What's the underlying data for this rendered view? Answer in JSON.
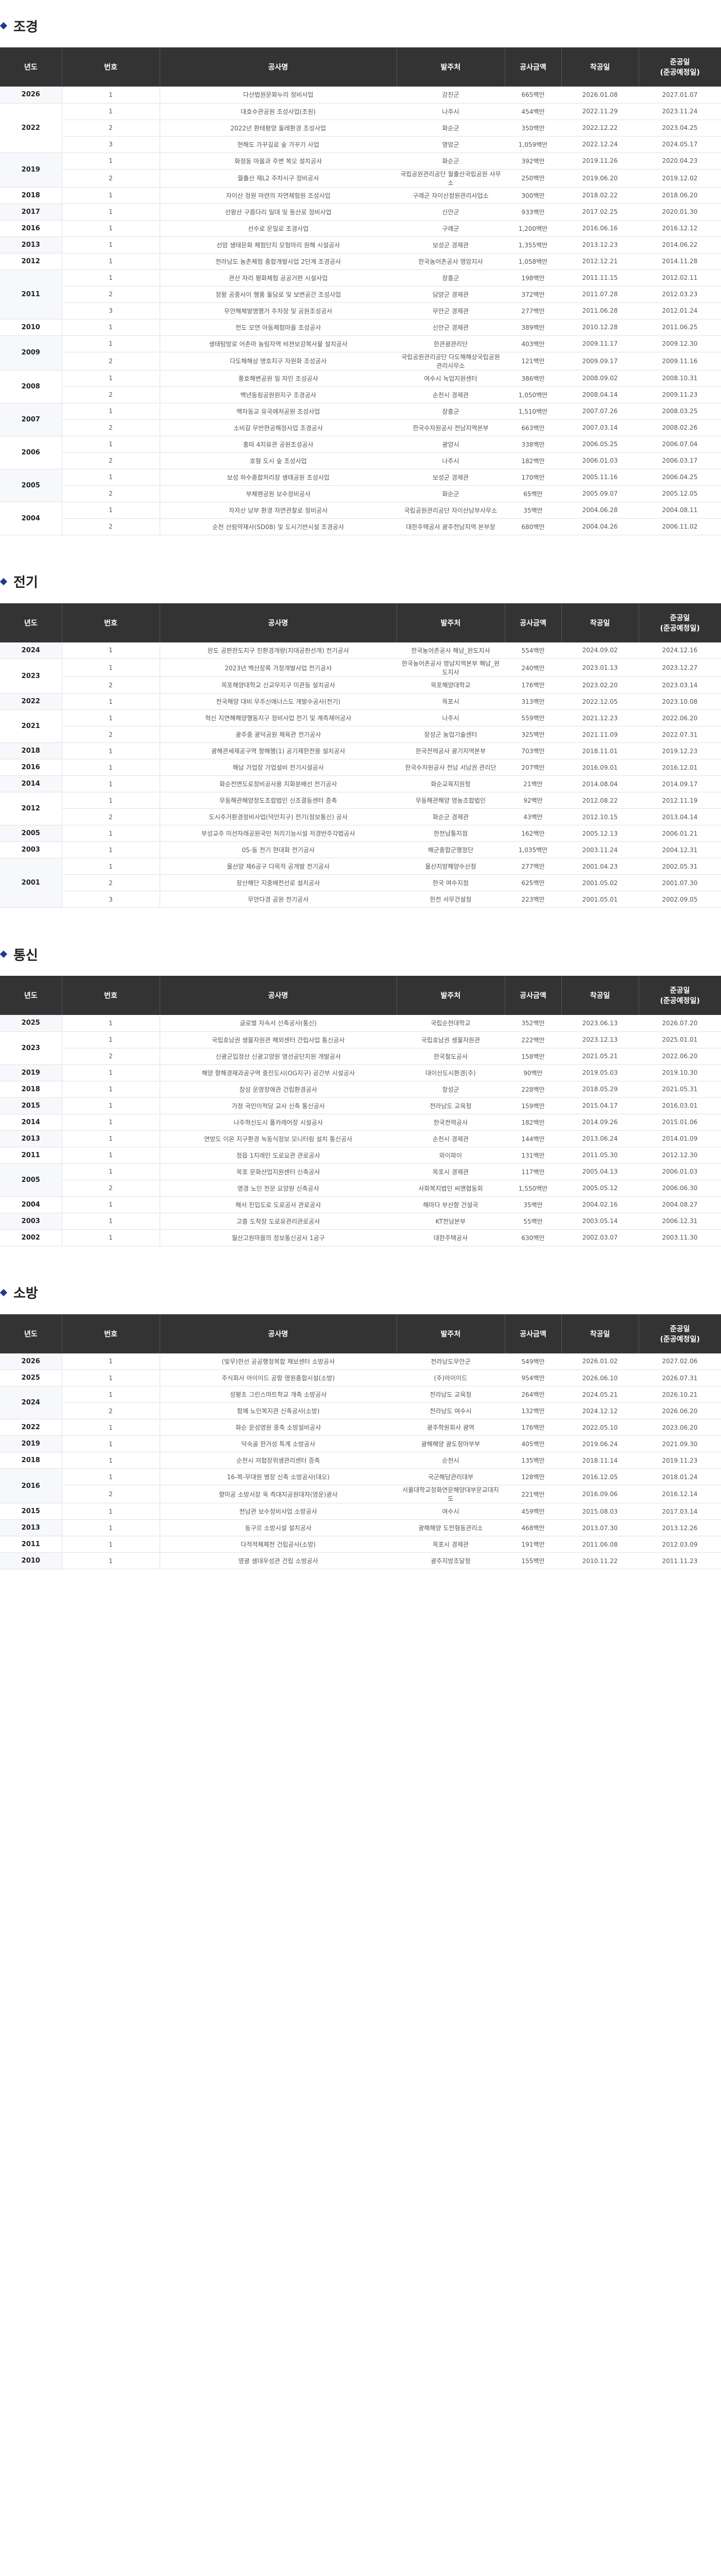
{
  "headers": [
    "년도",
    "번호",
    "공사명",
    "발주처",
    "공사금액",
    "착공일",
    "준공일\n(준공예정일)"
  ],
  "sections": [
    {
      "title": "조경",
      "groups": [
        {
          "year": "2026",
          "rows": [
            [
              "1",
              "다산법원문화누리 정비사업",
              "강진군",
              "665백만",
              "2026.01.08",
              "2027.01.07"
            ]
          ]
        },
        {
          "year": "2022",
          "rows": [
            [
              "1",
              "대호수관공원 조성사업(조원)",
              "나주시",
              "454백만",
              "2022.11.29",
              "2023.11.24"
            ],
            [
              "2",
              "2022년 환태평양 둘레환경 조성사업",
              "화순군",
              "350백만",
              "2022.12.22",
              "2023.04.25"
            ],
            [
              "3",
              "현해도 가꾸길로 숲 가꾸기 사업",
              "영암군",
              "1,059백만",
              "2022.12.24",
              "2024.05.17"
            ]
          ]
        },
        {
          "year": "2019",
          "rows": [
            [
              "1",
              "화정동 마을과 주변 복오 설치공사",
              "화순군",
              "392백만",
              "2019.11.26",
              "2020.04.23"
            ],
            [
              "2",
              "월출산 제L2 주차시구 정비공사",
              "국립공원관리공단 월출산국립공원 사무소",
              "250백만",
              "2019.06.20",
              "2019.12.02"
            ]
          ]
        },
        {
          "year": "2018",
          "rows": [
            [
              "1",
              "자이산 정원 마련의 자연체험원 조성사업",
              "구례군 자이산정원관리사업소",
              "300백만",
              "2018.02.22",
              "2018.06.20"
            ]
          ]
        },
        {
          "year": "2017",
          "rows": [
            [
              "1",
              "선왕산 구름다리 일대 및 등산로 정비사업",
              "신안군",
              "933백만",
              "2017.02.25",
              "2020.01.30"
            ]
          ]
        },
        {
          "year": "2016",
          "rows": [
            [
              "1",
              "선수로 문일로 조경사업",
              "구례군",
              "1,200백만",
              "2016.06.16",
              "2016.12.12"
            ]
          ]
        },
        {
          "year": "2013",
          "rows": [
            [
              "1",
              "선암 생태문화 체험단지 모험마리 원해 시설공사",
              "보성군 경제관",
              "1,355백만",
              "2013.12.23",
              "2014.06.22"
            ]
          ]
        },
        {
          "year": "2012",
          "rows": [
            [
              "1",
              "전라남도 농촌체험 종합개발사업 2단계 조경공사",
              "한국농어촌공사 영암지사",
              "1,058백만",
              "2012.12.21",
              "2014.11.28"
            ]
          ]
        },
        {
          "year": "2011",
          "rows": [
            [
              "1",
              "관산 자리 평화체험 공공거판 시설사업",
              "장흥군",
              "198백만",
              "2011.11.15",
              "2012.02.11"
            ],
            [
              "2",
              "정왕 공중사이 행풍 둘담로 및 보변공간 조성사업",
              "담양군 경제관",
              "372백만",
              "2011.07.28",
              "2012.03.23"
            ],
            [
              "3",
              "무안해체발명행거 주차장 및 공원조성공사",
              "무안군 경제관",
              "277백만",
              "2011.06.28",
              "2012.01.24"
            ]
          ]
        },
        {
          "year": "2010",
          "rows": [
            [
              "1",
              "전도 모연 아동체험마을 조성공사",
              "신안군 경제관",
              "389백만",
              "2010.12.28",
              "2011.06.25"
            ]
          ]
        },
        {
          "year": "2009",
          "rows": [
            [
              "1",
              "생태탐방로 어촌마 농림자역 비젼보강복사물 설치공사",
              "한관광관리단",
              "403백만",
              "2009.11.17",
              "2009.12.30"
            ],
            [
              "2",
              "다도해해상 명호지구 자원화 조성공사",
              "국립공원관리공단 다도해해상국립공원관리사무소",
              "121백만",
              "2009.09.17",
              "2009.11.16"
            ]
          ]
        },
        {
          "year": "2008",
          "rows": [
            [
              "1",
              "풍호해변공원 일 자인 조성공사",
              "여수시 녹업지원센터",
              "386백만",
              "2008.09.02",
              "2008.10.31"
            ],
            [
              "2",
              "백년동림공원원지구 조경공사",
              "순천시 경제관",
              "1,050백만",
              "2008.04.14",
              "2009.11.23"
            ]
          ]
        },
        {
          "year": "2007",
          "rows": [
            [
              "1",
              "백자동교 유국에처공원 조성사업",
              "장흥군",
              "1,510백만",
              "2007.07.26",
              "2008.03.25"
            ],
            [
              "2",
              "소비갈 무반현공해정사업 조경공사",
              "한국수자원공사 전남지역본부",
              "663백만",
              "2007.03.14",
              "2008.02.26"
            ]
          ]
        },
        {
          "year": "2006",
          "rows": [
            [
              "1",
              "홍따 4지유관 공원조성공사",
              "광양시",
              "338백만",
              "2006.05.25",
              "2006.07.04"
            ],
            [
              "2",
              "호형 도시 숲 조성사업",
              "나주시",
              "182백만",
              "2006.01.03",
              "2006.03.17"
            ]
          ]
        },
        {
          "year": "2005",
          "rows": [
            [
              "1",
              "보성 하수종합처리장 생태공원 조성사업",
              "보성군 경제관",
              "170백만",
              "2005.11.16",
              "2006.04.25"
            ],
            [
              "2",
              "부체렌공원 보수정비공사",
              "화순군",
              "65백만",
              "2005.09.07",
              "2005.12.05"
            ]
          ]
        },
        {
          "year": "2004",
          "rows": [
            [
              "1",
              "자자산 남부 환경 자연관찰로 정비공사",
              "국립공원관리공단 자이산남부사무소",
              "35백만",
              "2004.06.28",
              "2004.08.11"
            ],
            [
              "2",
              "순천 산림약재사(SD08) 및 도시기반시설 조경공사",
              "대한주택공사 광주전남지역 본부장",
              "680백만",
              "2004.04.26",
              "2006.11.02"
            ]
          ]
        }
      ]
    },
    {
      "title": "전기",
      "groups": [
        {
          "year": "2024",
          "rows": [
            [
              "1",
              "완도 공판한도지구 진환경개량(지대공판선개) 전기공사",
              "한국농어촌공사 해남_완도지사",
              "554백만",
              "2024.09.02",
              "2024.12.16"
            ]
          ]
        },
        {
          "year": "2023",
          "rows": [
            [
              "1",
              "2023년 백산장록 가정개발사업 전기공사",
              "한국농어촌공사 영남지역본부 해남_완도지사",
              "240백만",
              "2023.01.13",
              "2023.12.27"
            ],
            [
              "2",
              "목포해양대학교 신교무지구 미관동 설치공사",
              "목포해양대학교",
              "176백만",
              "2023.02.20",
              "2023.03.14"
            ]
          ]
        },
        {
          "year": "2022",
          "rows": [
            [
              "1",
              "전국해양 대비 무주신에너스도 개발수공사(전기)",
              "목포시",
              "313백만",
              "2022.12.05",
              "2023.10.08"
            ]
          ]
        },
        {
          "year": "2021",
          "rows": [
            [
              "1",
              "혁신 지연해해양행동지구 정비사업 전기 및 계측제어공사",
              "나주시",
              "559백만",
              "2021.12.23",
              "2022.06.20"
            ],
            [
              "2",
              "광주중 광덕공원 체육관 전기공사",
              "장성군 농업기술센터",
              "325백만",
              "2021.11.09",
              "2022.07.31"
            ]
          ]
        },
        {
          "year": "2018",
          "rows": [
            [
              "1",
              "광해관세제공구역 항해행(1) 공기제한전용 설치공사",
              "한국전력공사 광기지역본부",
              "703백만",
              "2018.11.01",
              "2019.12.23"
            ]
          ]
        },
        {
          "year": "2016",
          "rows": [
            [
              "1",
              "해남 가업장 가업설비 전기시설공사",
              "한국수자원공사 전남 서남권 관리단",
              "207백만",
              "2016.09.01",
              "2016.12.01"
            ]
          ]
        },
        {
          "year": "2014",
          "rows": [
            [
              "1",
              "화순전면도로정비공사용 지화분배선 전기공사",
              "화순교육지원청",
              "21백만",
              "2014.08.04",
              "2014.09.17"
            ]
          ]
        },
        {
          "year": "2012",
          "rows": [
            [
              "1",
              "무동해관해양정도조합법인 신조결동센터 증축",
              "무동해관해양 영농조합법인",
              "92백만",
              "2012.08.22",
              "2012.11.19"
            ],
            [
              "2",
              "도시주거환경정비사업(덕안지구) 전기(정보통신) 공사",
              "화순군 경제관",
              "43백만",
              "2012.10.15",
              "2013.04.14"
            ]
          ]
        },
        {
          "year": "2005",
          "rows": [
            [
              "1",
              "부성교주 미선자래공원국민 처리기능시설 저경반주각법공사",
              "한전남통지점",
              "162백만",
              "2005.12.13",
              "2006.01.21"
            ]
          ]
        },
        {
          "year": "2003",
          "rows": [
            [
              "1",
              "05-동 전기 현대화 전기공사",
              "해군종합군행정단",
              "1,035백만",
              "2003.11.24",
              "2004.12.31"
            ]
          ]
        },
        {
          "year": "2001",
          "rows": [
            [
              "1",
              "울산양 제6공구 다목적 공개발 전기공사",
              "울산지방해양수산청",
              "277백만",
              "2001.04.23",
              "2002.05.31"
            ],
            [
              "2",
              "장산해단 지중배전선로 설치공사",
              "한국 여수지점",
              "625백만",
              "2001.05.02",
              "2001.07.30"
            ],
            [
              "3",
              "무안다경 공원 전기공사",
              "한전 서무건설청",
              "223백만",
              "2001.05.01",
              "2002.09.05"
            ]
          ]
        }
      ]
    },
    {
      "title": "통신",
      "groups": [
        {
          "year": "2025",
          "rows": [
            [
              "1",
              "글로벌 자속서 신축공사(통신)",
              "국립순천대학교",
              "352백만",
              "2023.06.13",
              "2026.07.20"
            ]
          ]
        },
        {
          "year": "2023",
          "rows": [
            [
              "1",
              "국립호남권 생물자원관 해외센터 건립사업 통신공사",
              "국립호남권 생물자원관",
              "222백만",
              "2023.12.13",
              "2025.01.01"
            ],
            [
              "2",
              "신광군입정산 신광고양원 영선공단지원 개발공사",
              "한국철도공사",
              "158백만",
              "2021.05.21",
              "2022.06.20"
            ]
          ]
        },
        {
          "year": "2019",
          "rows": [
            [
              "1",
              "해양 항해경재과공구역 중진도시(OG지구) 공간부 시설공사",
              "대이산도시환경(주)",
              "90백만",
              "2019.05.03",
              "2019.10.30"
            ]
          ]
        },
        {
          "year": "2018",
          "rows": [
            [
              "1",
              "창성 운영장애관 건립환경공사",
              "창성군",
              "228백만",
              "2018.05.29",
              "2021.05.31"
            ]
          ]
        },
        {
          "year": "2015",
          "rows": [
            [
              "1",
              "가정 국민이적당 교사 신축 통신공사",
              "전라남도 교육청",
              "159백만",
              "2015.04.17",
              "2016.03.01"
            ]
          ]
        },
        {
          "year": "2014",
          "rows": [
            [
              "1",
              "나주혁신도시 폴카레어장 시설공사",
              "한국전력공사",
              "182백만",
              "2014.09.26",
              "2015.01.06"
            ]
          ]
        },
        {
          "year": "2013",
          "rows": [
            [
              "1",
              "연방도 이온 지구환경 녹동식정보 모니터링 설치 통신공사",
              "순천시 경제관",
              "144백만",
              "2013.06.24",
              "2014.01.09"
            ]
          ]
        },
        {
          "year": "2011",
          "rows": [
            [
              "1",
              "정읍 1지레인 도로요관 관로공사",
              "와이파이",
              "131백만",
              "2011.05.30",
              "2012.12.30"
            ]
          ]
        },
        {
          "year": "2005",
          "rows": [
            [
              "1",
              "목포 문화산업지원센터 신축공사",
              "목포시 경제관",
              "117백만",
              "2005.04.13",
              "2006.01.03"
            ],
            [
              "2",
              "영경 노인 전문 요양원 신축공사",
              "사회복지법인 씨앤협동회",
              "1,550백만",
              "2005.05.12",
              "2006.06.30"
            ]
          ]
        },
        {
          "year": "2004",
          "rows": [
            [
              "1",
              "해서 진입도로 도로공사 관로공사",
              "해마다 부산항 건설국",
              "35백만",
              "2004.02.16",
              "2004.08.27"
            ]
          ]
        },
        {
          "year": "2003",
          "rows": [
            [
              "1",
              "고흥 도착장 도로유관리관로공사",
              "KT전남본부",
              "55백만",
              "2003.05.14",
              "2006.12.31"
            ]
          ]
        },
        {
          "year": "2002",
          "rows": [
            [
              "1",
              "월산고원마을의 정보통신공사 1공구",
              "대한주택공사",
              "630백만",
              "2002.03.07",
              "2003.11.30"
            ]
          ]
        }
      ]
    },
    {
      "title": "소방",
      "groups": [
        {
          "year": "2026",
          "rows": [
            [
              "1",
              "(빛무)한선 공공행정복합 채보센터 소방공사",
              "전라남도무안군",
              "549백만",
              "2026.01.02",
              "2027.02.06"
            ]
          ]
        },
        {
          "year": "2025",
          "rows": [
            [
              "1",
              "주식회사 아이이드 공항 영원종합시설(소방)",
              "(주)아이이드",
              "954백만",
              "2026.06.10",
              "2026.07.31"
            ]
          ]
        },
        {
          "year": "2024",
          "rows": [
            [
              "1",
              "성평초 그린스마트학교 개축 소방공사",
              "전라남도 교육청",
              "264백만",
              "2024.05.21",
              "2026.10.21"
            ],
            [
              "2",
              "함께 노인복지관 신축공사(소방)",
              "전라남도 여수시",
              "132백만",
              "2024.12.12",
              "2026.06.20"
            ]
          ]
        },
        {
          "year": "2022",
          "rows": [
            [
              "1",
              "화순 운성영원 중축 소방설비공사",
              "광주학원회사 광역",
              "176백만",
              "2022.05.10",
              "2023.06.20"
            ]
          ]
        },
        {
          "year": "2019",
          "rows": [
            [
              "1",
              "덕숙골 한거성 특계 소방공사",
              "광해해양 광도청마부부",
              "405백만",
              "2019.06.24",
              "2021.09.30"
            ]
          ]
        },
        {
          "year": "2018",
          "rows": [
            [
              "1",
              "순천시 저협장위생관리센터 증축",
              "순천시",
              "135백만",
              "2018.11.14",
              "2019.11.23"
            ]
          ]
        },
        {
          "year": "2016",
          "rows": [
            [
              "1",
              "16-복-무대원 병장 신축 소방공사(대오)",
              "국군해당관리대부",
              "128백만",
              "2016.12.05",
              "2018.01.24"
            ],
            [
              "2",
              "향미공 소방서장 옥 측대지공원대자(영운)광사",
              "서울대학교정화연문해양대부문교대지도",
              "221백만",
              "2016.09.06",
              "2016.12.14"
            ]
          ]
        },
        {
          "year": "2015",
          "rows": [
            [
              "1",
              "전남관 보수정비사업 소방공사",
              "여수시",
              "459백만",
              "2015.08.03",
              "2017.03.14"
            ]
          ]
        },
        {
          "year": "2013",
          "rows": [
            [
              "1",
              "동구르 소방시설 설치공사",
              "광해해양 도전형동관리소",
              "468백만",
              "2013.07.30",
              "2013.12.26"
            ]
          ]
        },
        {
          "year": "2011",
          "rows": [
            [
              "1",
              "다적적체체전 건립공사(소방)",
              "목포시 경제관",
              "191백만",
              "2011.06.08",
              "2012.03.09"
            ]
          ]
        },
        {
          "year": "2010",
          "rows": [
            [
              "1",
              "영광 생대우성관 건립 소방공사",
              "광주지방조달청",
              "155백만",
              "2010.11.22",
              "2011.11.23"
            ]
          ]
        }
      ]
    }
  ]
}
